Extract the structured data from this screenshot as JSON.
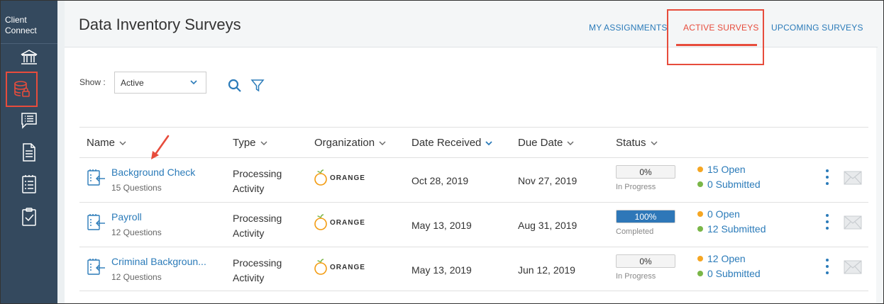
{
  "sidebar": {
    "brand_line1": "Client",
    "brand_line2": "Connect",
    "items": [
      {
        "icon": "bank-icon"
      },
      {
        "icon": "database-lock-icon",
        "active": true
      },
      {
        "icon": "list-card-icon"
      },
      {
        "icon": "document-icon"
      },
      {
        "icon": "checklist-icon"
      },
      {
        "icon": "clipboard-check-icon"
      }
    ]
  },
  "header": {
    "title": "Data Inventory Surveys",
    "tabs": [
      {
        "label": "MY ASSIGNMENTS"
      },
      {
        "label": "ACTIVE SURVEYS",
        "active": true
      },
      {
        "label": "UPCOMING SURVEYS"
      }
    ]
  },
  "filters": {
    "show_label": "Show :",
    "show_value": "Active"
  },
  "table": {
    "columns": [
      "Name",
      "Type",
      "Organization",
      "Date Received",
      "Due Date",
      "Status"
    ],
    "rows": [
      {
        "name": "Background Check",
        "questions": "15 Questions",
        "type_line1": "Processing",
        "type_line2": "Activity",
        "org": "ORANGE",
        "date_received": "Oct 28, 2019",
        "due_date": "Nov 27, 2019",
        "progress_percent": 0,
        "progress_label": "0%",
        "status": "In Progress",
        "open": "15 Open",
        "submitted": "0 Submitted"
      },
      {
        "name": "Payroll",
        "questions": "12 Questions",
        "type_line1": "Processing",
        "type_line2": "Activity",
        "org": "ORANGE",
        "date_received": "May 13, 2019",
        "due_date": "Aug 31, 2019",
        "progress_percent": 100,
        "progress_label": "100%",
        "status": "Completed",
        "open": "0 Open",
        "submitted": "12 Submitted"
      },
      {
        "name": "Criminal Backgroun...",
        "questions": "12 Questions",
        "type_line1": "Processing",
        "type_line2": "Activity",
        "org": "ORANGE",
        "date_received": "May 13, 2019",
        "due_date": "Jun 12, 2019",
        "progress_percent": 0,
        "progress_label": "0%",
        "status": "In Progress",
        "open": "12 Open",
        "submitted": "0 Submitted"
      }
    ]
  },
  "colors": {
    "sidebar": "#34495e",
    "accent": "#2b7bb9",
    "highlight": "#e74c3c",
    "open_dot": "#f5a623",
    "submitted_dot": "#7ab648"
  }
}
